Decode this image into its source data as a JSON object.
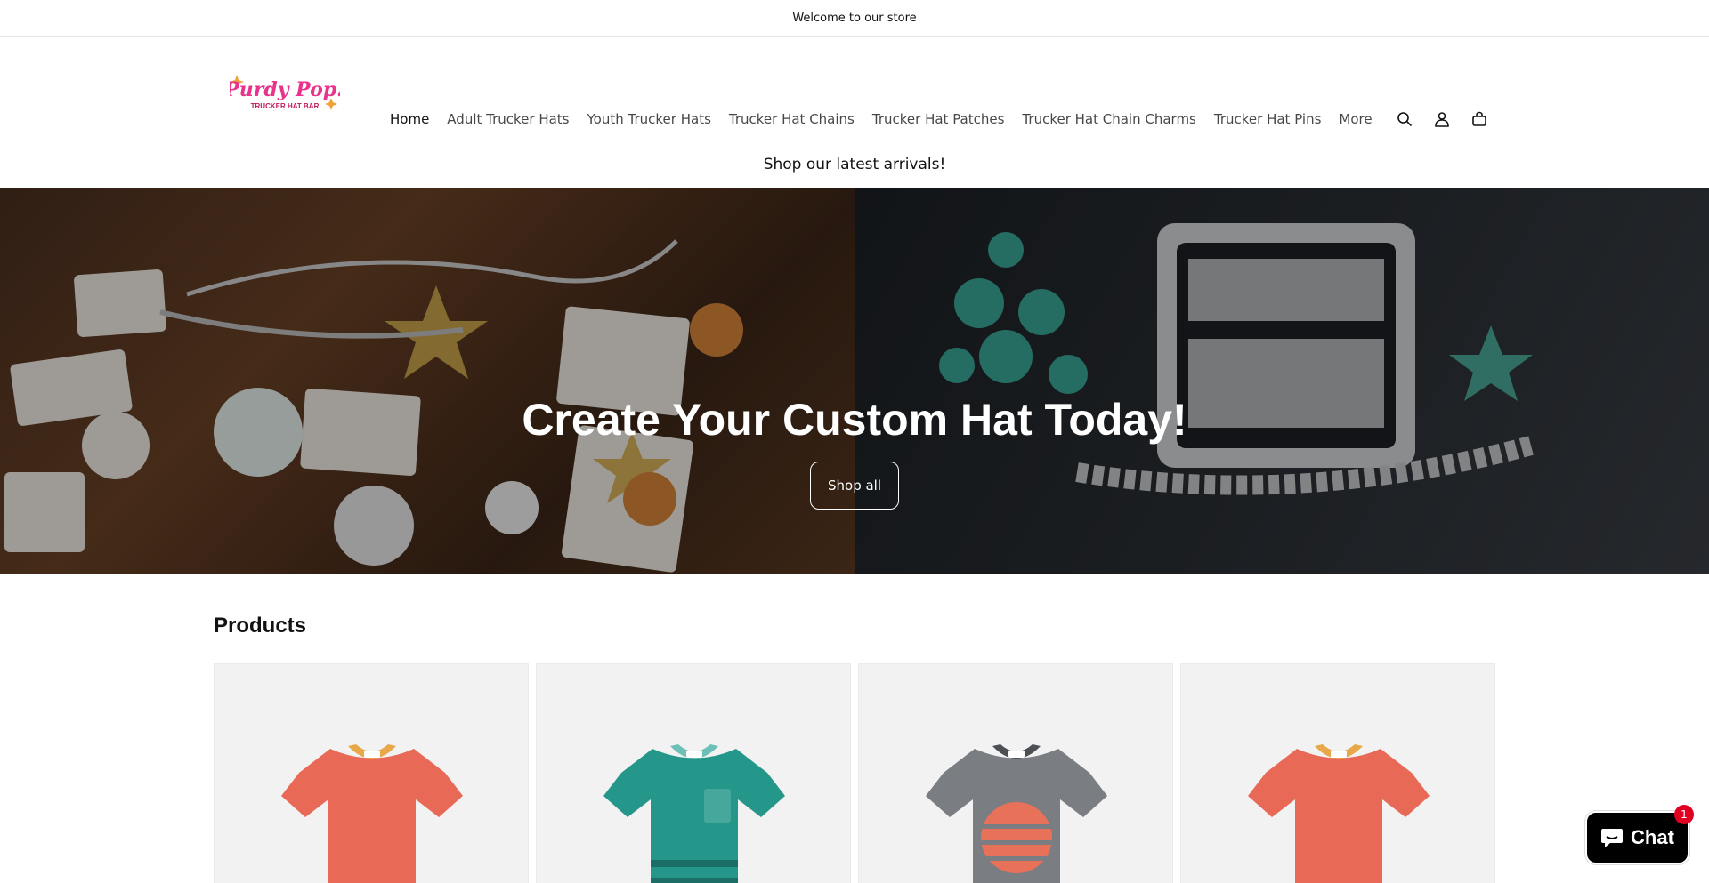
{
  "announcement": {
    "text": "Welcome to our store"
  },
  "header": {
    "logo": {
      "line1": "Purdy Pop!",
      "line2": "TRUCKER HAT BAR"
    },
    "nav": [
      {
        "label": "Home",
        "active": true
      },
      {
        "label": "Adult Trucker Hats"
      },
      {
        "label": "Youth Trucker Hats"
      },
      {
        "label": "Trucker Hat Chains"
      },
      {
        "label": "Trucker Hat Patches"
      },
      {
        "label": "Trucker Hat Chain Charms"
      },
      {
        "label": "Trucker Hat Pins"
      },
      {
        "label": "More"
      }
    ],
    "icons": [
      "search-icon",
      "account-icon",
      "cart-icon"
    ]
  },
  "banner": {
    "subtitle": "Shop our latest arrivals!"
  },
  "hero": {
    "title": "Create Your Custom Hat Today!",
    "button": "Shop all"
  },
  "products": {
    "heading": "Products",
    "items": [
      {
        "shirt_color": "#e86a56",
        "collar_color": "#e8a84a"
      },
      {
        "shirt_color": "#24968a",
        "collar_color": "#6cc0b8"
      },
      {
        "shirt_color": "#7a7d82",
        "collar_color": "#4c4f54"
      },
      {
        "shirt_color": "#e86a56",
        "collar_color": "#e8a84a"
      }
    ]
  },
  "chat": {
    "label": "Chat",
    "badge": "1"
  },
  "colors": {
    "accent": "#121212",
    "chat_bg": "#000000",
    "badge": "#e00022"
  }
}
